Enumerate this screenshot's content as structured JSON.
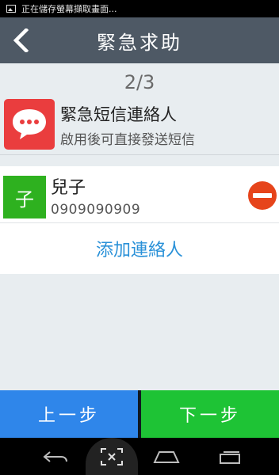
{
  "status_bar": {
    "text": "正在儲存螢幕擷取畫面..."
  },
  "app_bar": {
    "title": "緊急求助"
  },
  "step": {
    "label": "2/3"
  },
  "sms": {
    "title": "緊急短信連絡人",
    "subtitle": "啟用後可直接發送短信",
    "icon": "chat-bubble-icon"
  },
  "contacts": [
    {
      "avatar_letter": "子",
      "name": "兒子",
      "phone": "0909090909"
    }
  ],
  "add_contact": {
    "label": "添加連絡人"
  },
  "buttons": {
    "prev_label": "上一步",
    "next_label": "下一步"
  },
  "colors": {
    "app_bar": "#4e5965",
    "sms_icon": "#ea3d3e",
    "avatar": "#2eb11f",
    "remove": "#e6441b",
    "link": "#2a91d8",
    "prev": "#2f86ea",
    "next": "#1ec335"
  },
  "nav": {
    "icons": [
      "back-icon",
      "screenshot-icon",
      "home-icon",
      "recent-apps-icon"
    ]
  }
}
